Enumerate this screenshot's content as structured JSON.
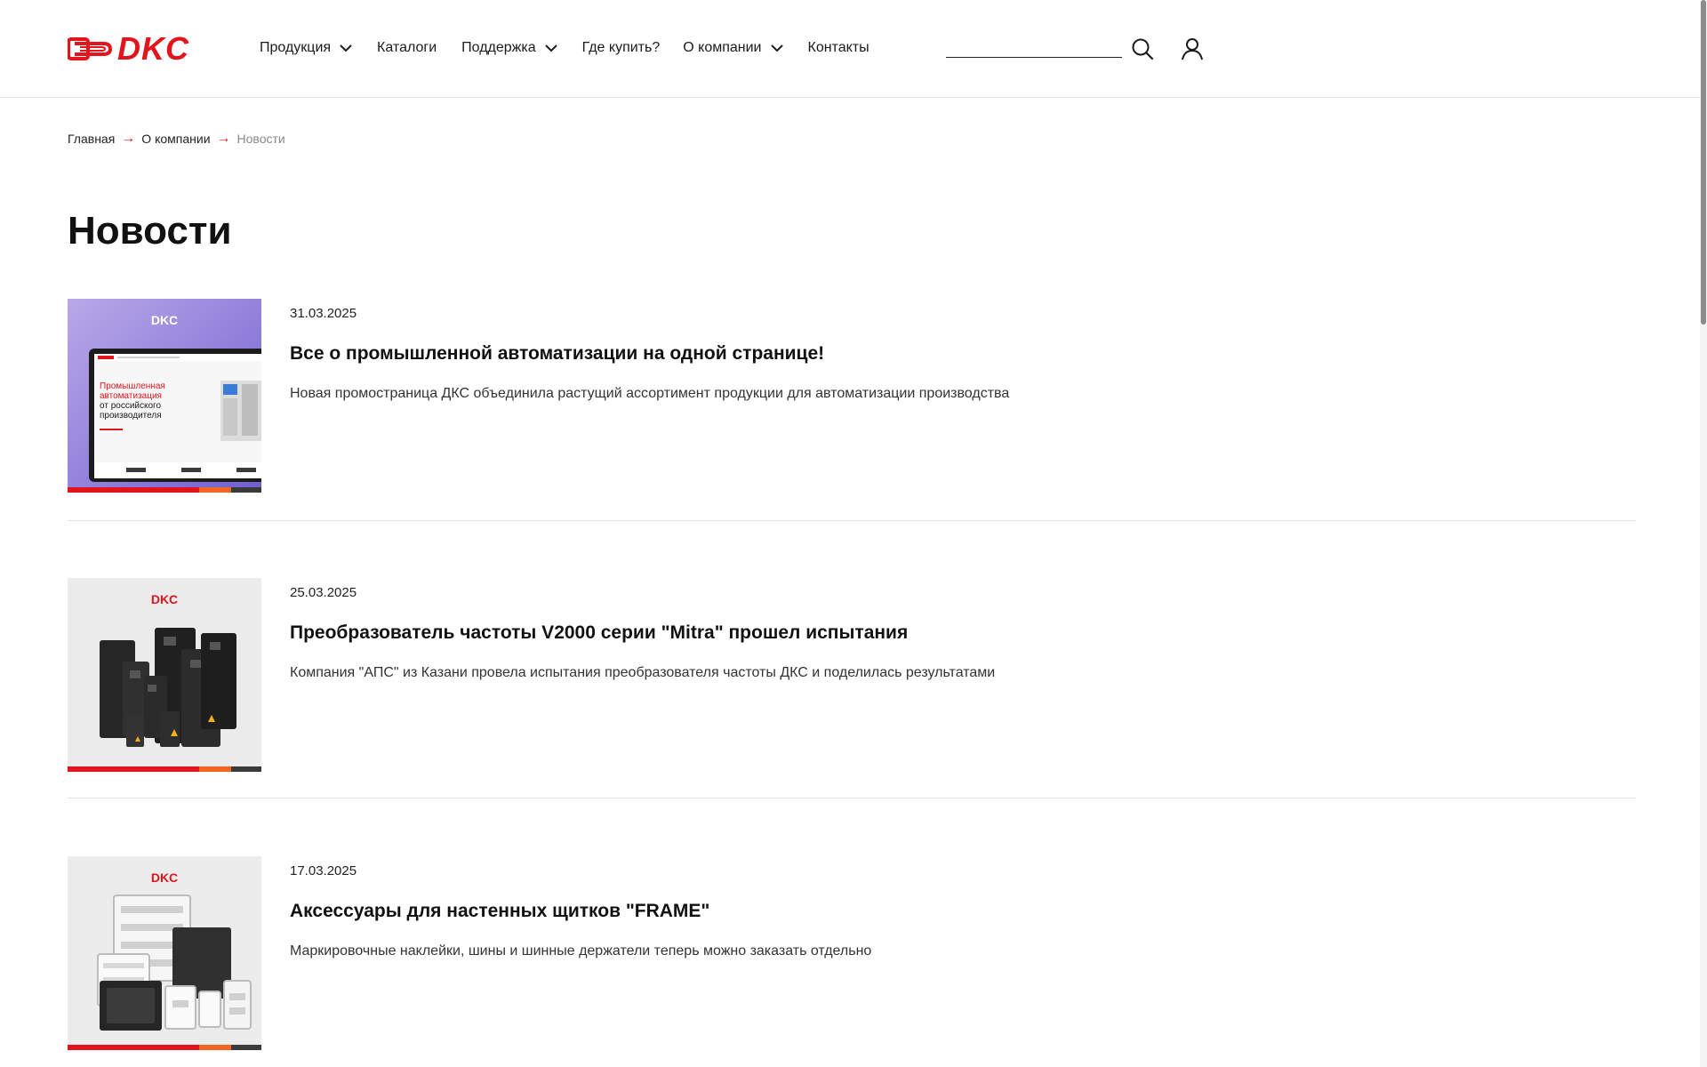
{
  "header": {
    "logo_text": "DKC",
    "nav": [
      {
        "label": "Продукция",
        "has_dropdown": true
      },
      {
        "label": "Каталоги",
        "has_dropdown": false
      },
      {
        "label": "Поддержка",
        "has_dropdown": true
      },
      {
        "label": "Где купить?",
        "has_dropdown": false
      },
      {
        "label": "О компании",
        "has_dropdown": true
      },
      {
        "label": "Контакты",
        "has_dropdown": false
      }
    ],
    "search_value": "",
    "search_icon": "search-icon",
    "user_icon": "user-icon"
  },
  "breadcrumb": {
    "items": [
      "Главная",
      "О компании"
    ],
    "current": "Новости",
    "separator": "→"
  },
  "page_title": "Новости",
  "news": [
    {
      "date": "31.03.2025",
      "title": "Все о промышленной автоматизации на одной странице!",
      "description": "Новая промостраница ДКС объединила растущий ассортимент продукции для автоматизации производства",
      "thumb_logo": "DKC",
      "thumb_caption": [
        "Промышленная",
        "автоматизация",
        "от российского",
        "производителя"
      ]
    },
    {
      "date": "25.03.2025",
      "title": "Преобразователь частоты V2000 серии \"Mitra\" прошел испытания",
      "description": "Компания \"АПС\" из Казани провела испытания преобразователя частоты ДКС и поделилась результатами",
      "thumb_logo": "DKC"
    },
    {
      "date": "17.03.2025",
      "title": "Аксессуары для настенных щитков \"FRAME\"",
      "description": "Маркировочные наклейки, шины и шинные держатели теперь можно заказать отдельно",
      "thumb_logo": "DKC"
    }
  ],
  "colors": {
    "brand_red": "#e2141c",
    "accent_orange": "#f26522",
    "dark_gray": "#3a3a3a"
  }
}
